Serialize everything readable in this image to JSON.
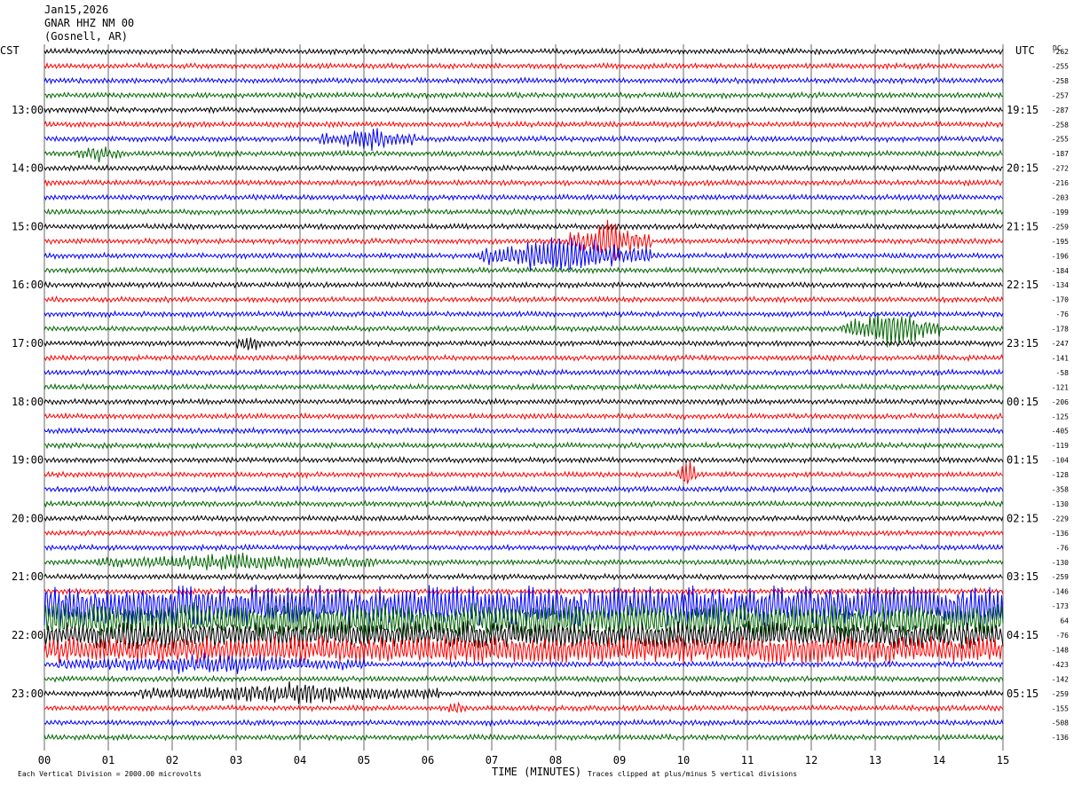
{
  "header": {
    "date": "Jan15,2026",
    "station": "GNAR HHZ NM 00",
    "location": "(Gosnell, AR)"
  },
  "axes": {
    "left_tz": "CST",
    "right_tz": "UTC",
    "dc_label": "DC",
    "xlabel": "TIME (MINUTES)",
    "left_hours": [
      "13:00",
      "14:00",
      "15:00",
      "16:00",
      "17:00",
      "18:00",
      "19:00",
      "20:00",
      "21:00",
      "22:00",
      "23:00"
    ],
    "right_hours": [
      "19:15",
      "20:15",
      "21:15",
      "22:15",
      "23:15",
      "00:15",
      "01:15",
      "02:15",
      "03:15",
      "04:15",
      "05:15"
    ],
    "minute_ticks": [
      "00",
      "01",
      "02",
      "03",
      "04",
      "05",
      "06",
      "07",
      "08",
      "09",
      "10",
      "11",
      "12",
      "13",
      "14",
      "15"
    ]
  },
  "footer": {
    "scale": "Each Vertical Division = 2000.00 microvolts",
    "clip": "Traces clipped at plus/minus 5 vertical divisions"
  },
  "colors": {
    "cycle": [
      "#000000",
      "#ff0000",
      "#0000ff",
      "#006600"
    ],
    "grid": "#000000"
  },
  "chart_data": {
    "type": "helicorder",
    "traces_per_hour": 4,
    "trace_minutes": 15,
    "first_trace_start": "12:15 CST",
    "xlim": [
      0,
      15
    ],
    "dc_offsets": [
      "-262",
      "-255",
      "-258",
      "-257",
      "-287",
      "-258",
      "-255",
      "-187",
      "-272",
      "-216",
      "-203",
      "-199",
      "-259",
      "-195",
      "-196",
      "-184",
      "-134",
      "-170",
      "-76",
      "-178",
      "-247",
      "-141",
      "-58",
      "-121",
      "-206",
      "-125",
      "-405",
      "-119",
      "-104",
      "-128",
      "-358",
      "-130",
      "-229",
      "-136",
      "-76",
      "-130",
      "-259",
      "-146",
      "-173",
      "64",
      "-76",
      "-148",
      "-423",
      "-142",
      "-259",
      "-155",
      "-508",
      "-136"
    ],
    "events": [
      {
        "trace": 6,
        "start_min": 4.3,
        "end_min": 5.8,
        "amp": 2.2,
        "note": "burst"
      },
      {
        "trace": 7,
        "start_min": 0.5,
        "end_min": 1.2,
        "amp": 1.4
      },
      {
        "trace": 13,
        "start_min": 8.2,
        "end_min": 9.5,
        "amp": 4.0
      },
      {
        "trace": 14,
        "start_min": 6.8,
        "end_min": 9.5,
        "amp": 4.0
      },
      {
        "trace": 19,
        "start_min": 12.5,
        "end_min": 14.0,
        "amp": 4.0
      },
      {
        "trace": 20,
        "start_min": 3.0,
        "end_min": 3.4,
        "amp": 1.6
      },
      {
        "trace": 29,
        "start_min": 9.9,
        "end_min": 10.2,
        "amp": 3.5
      },
      {
        "trace": 35,
        "start_min": 0.8,
        "end_min": 5.2,
        "amp": 1.4
      },
      {
        "trace": 38,
        "start_min": 0,
        "end_min": 15,
        "amp": 3.5
      },
      {
        "trace": 39,
        "start_min": 0,
        "end_min": 15,
        "amp": 3.0
      },
      {
        "trace": 40,
        "start_min": 0,
        "end_min": 15,
        "amp": 2.2
      },
      {
        "trace": 41,
        "start_min": 0,
        "end_min": 15,
        "amp": 2.2
      },
      {
        "trace": 42,
        "start_min": 0.2,
        "end_min": 5.0,
        "amp": 1.8
      },
      {
        "trace": 44,
        "start_min": 1.5,
        "end_min": 6.2,
        "amp": 1.8
      },
      {
        "trace": 45,
        "start_min": 6.3,
        "end_min": 6.6,
        "amp": 1.3
      }
    ]
  }
}
